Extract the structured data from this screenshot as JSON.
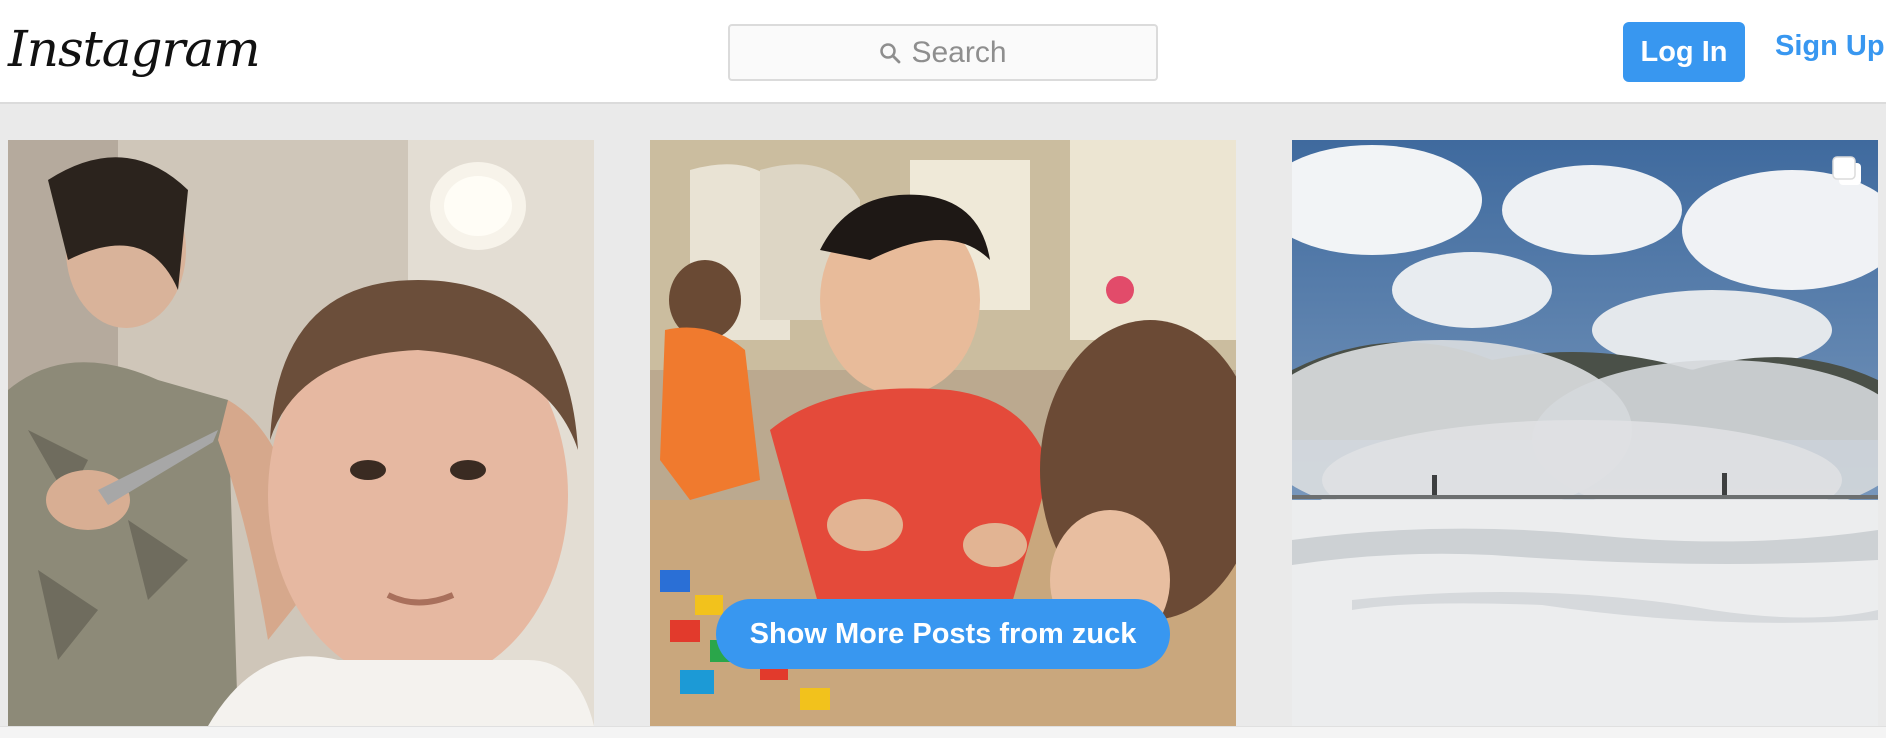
{
  "header": {
    "logo_text": "Instagram",
    "search": {
      "placeholder": "Search"
    },
    "login_label": "Log In",
    "signup_label": "Sign Up"
  },
  "posts": [
    {
      "icon": "photo"
    },
    {
      "icon": "photo"
    },
    {
      "icon": "photo",
      "badge_icon": "multiple-posts-icon"
    }
  ],
  "show_more_label": "Show More Posts from zuck",
  "colors": {
    "accent": "#3897f0",
    "header_border": "#dbdbdb",
    "grid_background": "#eaeaea"
  }
}
